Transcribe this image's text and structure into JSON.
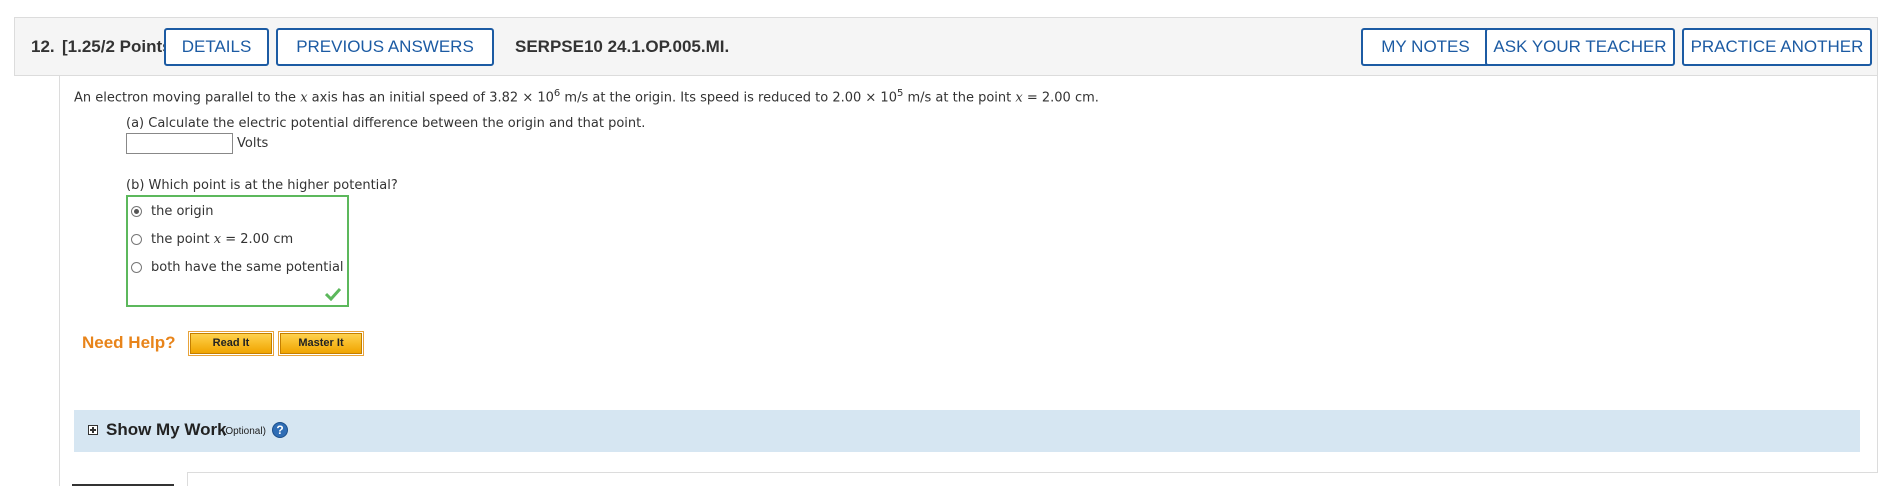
{
  "header": {
    "question_number": "12.",
    "points": "[1.25/2 Points]",
    "details_label": "DETAILS",
    "previous_answers_label": "PREVIOUS ANSWERS",
    "question_code": "SERPSE10 24.1.OP.005.MI.",
    "my_notes_label": "MY NOTES",
    "ask_teacher_label": "ASK YOUR TEACHER",
    "practice_another_label": "PRACTICE ANOTHER"
  },
  "problem": {
    "prompt_part1": "An electron moving parallel to the ",
    "var_x": "x",
    "prompt_part2": " axis has an initial speed of 3.82 × 10",
    "exp1": "6",
    "prompt_part3": " m/s at the origin. Its speed is reduced to 2.00 × 10",
    "exp2": "5",
    "prompt_part4": " m/s at the point ",
    "prompt_part5": " = 2.00 cm."
  },
  "part_a": {
    "question": "(a) Calculate the electric potential difference between the origin and that point.",
    "answer_value": "",
    "units": "Volts"
  },
  "part_b": {
    "question": "(b) Which point is at the higher potential?",
    "options": [
      {
        "label": "the origin",
        "selected": true
      },
      {
        "label_pre": "the point ",
        "label_var": "x",
        "label_post": " = 2.00 cm",
        "selected": false
      },
      {
        "label": "both have the same potential",
        "selected": false
      }
    ],
    "status": "correct",
    "status_icon": "checkmark-icon",
    "status_color": "#5cb85c"
  },
  "help": {
    "title": "Need Help?",
    "read_it": "Read It",
    "master_it": "Master It",
    "accent_color": "#e8841a"
  },
  "show_my_work": {
    "title": "Show My Work",
    "optional": "(Optional)",
    "help_icon": "question-circle-icon"
  },
  "colors": {
    "primary_blue": "#1c5ba3",
    "panel_blue": "#d6e6f2",
    "correct_green": "#5cb85c"
  }
}
